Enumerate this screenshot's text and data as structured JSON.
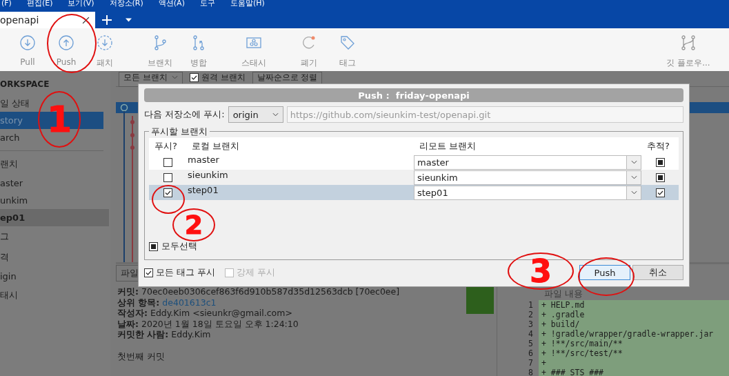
{
  "menu": [
    "(F)",
    "편집(E)",
    "보기(V)",
    "저장소(R)",
    "액션(A)",
    "도구",
    "도움말(H)"
  ],
  "tabs": [
    {
      "label": "openapi",
      "selected": true
    }
  ],
  "toolbar": {
    "groups": [
      [
        {
          "kind": "pull",
          "label": "Pull"
        },
        {
          "kind": "push",
          "label": "Push"
        },
        {
          "kind": "fetch",
          "label": "패치"
        }
      ],
      [
        {
          "kind": "branch",
          "label": "브랜치"
        },
        {
          "kind": "merge",
          "label": "병합"
        }
      ],
      [
        {
          "kind": "stash",
          "label": "스태시"
        }
      ],
      [
        {
          "kind": "discard",
          "label": "폐기"
        },
        {
          "kind": "tag",
          "label": "태그"
        }
      ]
    ],
    "right": [
      {
        "kind": "gitflow",
        "label": "깃 플로우..."
      }
    ]
  },
  "sidebar": {
    "heading": "ORKSPACE",
    "items": [
      {
        "label": "일 상태",
        "selected": false
      },
      {
        "label": "story",
        "selected": true
      },
      {
        "label": "arch",
        "selected": false
      }
    ],
    "sections": [
      {
        "title": "랜치",
        "items": [
          {
            "label": "aster",
            "selected": false
          },
          {
            "label": "unkim",
            "selected": false
          },
          {
            "label": "ep01",
            "selected": true
          }
        ]
      },
      {
        "title": "그"
      },
      {
        "title": "격",
        "items": [
          {
            "label": "igin",
            "selected": false
          }
        ]
      },
      {
        "title": "태시"
      }
    ]
  },
  "filters": {
    "branches": "모든 브랜치",
    "remote": {
      "label": "원격 브랜치",
      "checked": true
    },
    "sort": "날짜순으로 정렬"
  },
  "bottom": {
    "tab": "파일",
    "details": [
      {
        "kind": "text",
        "label": "커밋:",
        "value": "70ec0eeb0306cef863f6d910b587d35d12563dcb [70ec0ee]"
      },
      {
        "kind": "link",
        "label": "상위 항목:",
        "value": "de401613c1"
      },
      {
        "kind": "text",
        "label": "작성자:",
        "value": "Eddy.Kim <sieunkr@gmail.com>"
      },
      {
        "kind": "text",
        "label": "날짜:",
        "value": "2020년 1월 18일 토요일 오후 1:24:10"
      },
      {
        "kind": "text",
        "label": "커밋한 사람:",
        "value": "Eddy.Kim"
      }
    ],
    "message": "첫번째 커밋",
    "file_header": "파일 내용",
    "diff": [
      {
        "number": "1",
        "text": "+ HELP.md"
      },
      {
        "number": "2",
        "text": "+ .gradle"
      },
      {
        "number": "3",
        "text": "+ build/"
      },
      {
        "number": "4",
        "text": "+ !gradle/wrapper/gradle-wrapper.jar"
      },
      {
        "number": "5",
        "text": "+ !**/src/main/**"
      },
      {
        "number": "6",
        "text": "+ !**/src/test/**"
      },
      {
        "number": "7",
        "text": "+"
      },
      {
        "number": "8",
        "text": "+ ### STS ###"
      }
    ]
  },
  "dialog": {
    "title": "Push :  friday-openapi",
    "remote_label": "다음 저장소에 푸시:",
    "remote": "origin",
    "url": "https://github.com/sieunkim-test/openapi.git",
    "group_label": "푸시할 브랜치",
    "columns": [
      "푸시?",
      "로컬 브랜치",
      "리모트 브랜치",
      "추적?"
    ],
    "rows": [
      {
        "push": false,
        "local": "master",
        "remote": "master",
        "track_checked": false,
        "track_mixed": true,
        "selected": false
      },
      {
        "push": false,
        "local": "sieunkim",
        "remote": "sieunkim",
        "track_checked": false,
        "track_mixed": true,
        "selected": false
      },
      {
        "push": true,
        "local": "step01",
        "remote": "step01",
        "track_checked": true,
        "track_mixed": false,
        "selected": true
      }
    ],
    "select_all": {
      "label": "모두선택",
      "checked": false,
      "mixed": true
    },
    "push_tags": {
      "label": "모든 태그 푸시",
      "checked": true
    },
    "force_push": {
      "label": "강제 푸시",
      "checked": false,
      "disabled": true
    },
    "buttons": [
      {
        "label": "Push",
        "default": true
      },
      {
        "label": "취소",
        "default": false
      }
    ]
  },
  "annotations": [
    {
      "label": "1"
    },
    {
      "label": "2"
    },
    {
      "label": "3"
    }
  ]
}
